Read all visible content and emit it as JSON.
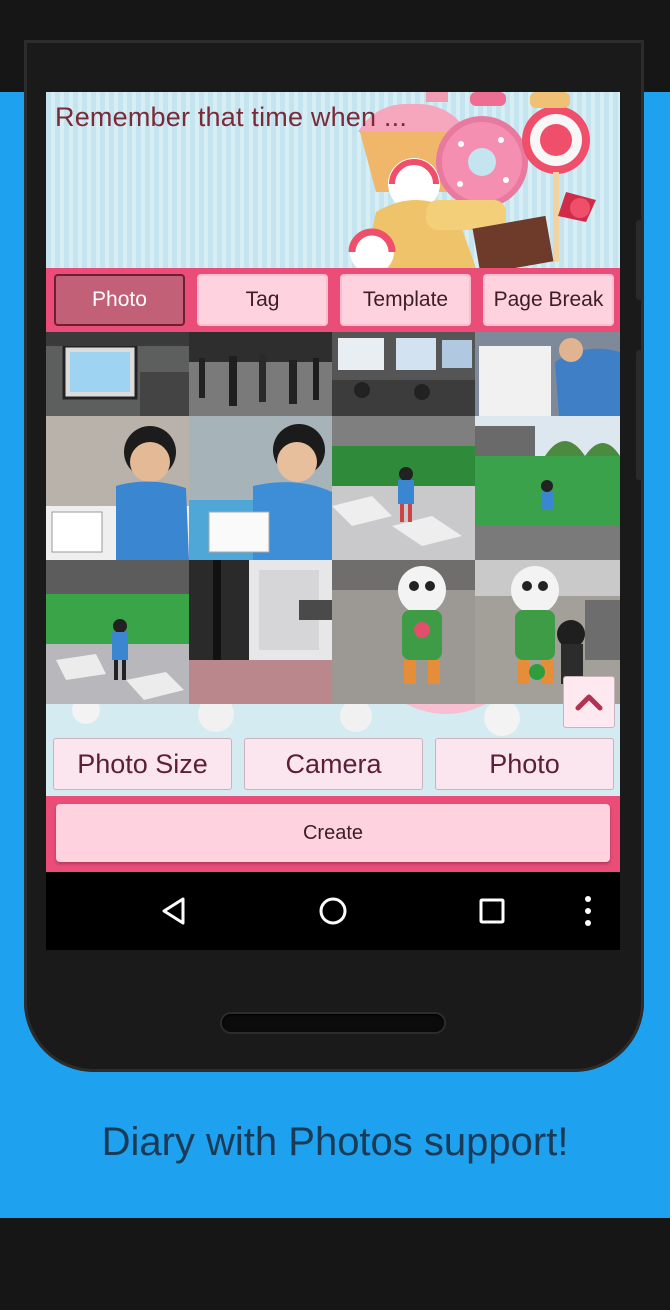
{
  "editor": {
    "text": "Remember that time when ..."
  },
  "tabs": [
    {
      "label": "Photo",
      "active": true
    },
    {
      "label": "Tag",
      "active": false
    },
    {
      "label": "Template",
      "active": false
    },
    {
      "label": "Page Break",
      "active": false
    }
  ],
  "photos": [
    {
      "id": "photo-1",
      "desc": "kiosk-screen"
    },
    {
      "id": "photo-2",
      "desc": "crowd-hall"
    },
    {
      "id": "photo-3",
      "desc": "exhibition-screens"
    },
    {
      "id": "photo-4",
      "desc": "child-drawing"
    },
    {
      "id": "photo-5",
      "desc": "child-at-table"
    },
    {
      "id": "photo-6",
      "desc": "child-drawing-2"
    },
    {
      "id": "photo-7",
      "desc": "child-on-plaza"
    },
    {
      "id": "photo-8",
      "desc": "child-on-lawn"
    },
    {
      "id": "photo-9",
      "desc": "child-walking"
    },
    {
      "id": "photo-10",
      "desc": "station-entrance"
    },
    {
      "id": "photo-11",
      "desc": "mascot-statue"
    },
    {
      "id": "photo-12",
      "desc": "mascot-with-child"
    }
  ],
  "actions": {
    "photo_size": "Photo Size",
    "camera": "Camera",
    "photo": "Photo"
  },
  "create_label": "Create",
  "caption": "Diary with Photos support!",
  "colors": {
    "accent": "#ea4d78",
    "tab_bg": "#fed2df",
    "tab_active": "#c26078",
    "background": "#1ea1ee"
  },
  "icons": {
    "scroll_top": "chevron-up-icon",
    "nav_back": "back-triangle-icon",
    "nav_home": "home-circle-icon",
    "nav_recents": "recents-square-icon",
    "nav_more": "more-vert-icon"
  }
}
